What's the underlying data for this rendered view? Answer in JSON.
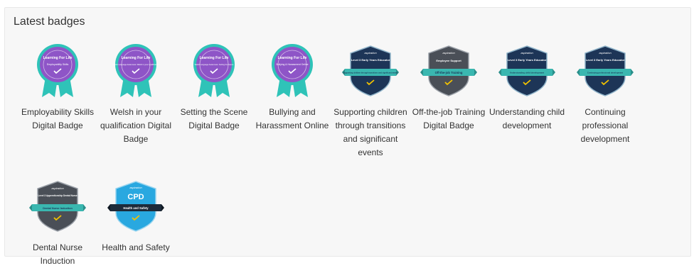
{
  "panel": {
    "title": "Latest badges"
  },
  "badges": [
    {
      "label": "Employability Skills Digital Badge",
      "icon": "rosette-icon",
      "header": "Learning For Life",
      "subtitle": "Employability Skills"
    },
    {
      "label": "Welsh in your qualification Digital Badge",
      "icon": "rosette-icon",
      "header": "Learning For Life",
      "subtitle": "Welsh Language Awareness: Welsh in your Qualification"
    },
    {
      "label": "Setting the Scene Digital Badge",
      "icon": "rosette-icon",
      "header": "Learning For Life",
      "subtitle": "Welsh Language Awareness: Setting the Scene"
    },
    {
      "label": "Bullying and Harassment Online",
      "icon": "rosette-icon",
      "header": "Learning For Life",
      "subtitle": "Bullying & Harassment Online"
    },
    {
      "label": "Supporting children through transitions and significant events",
      "icon": "shield-icon",
      "brand": "aspiration",
      "header": "Level 3 Early Years Educator",
      "ribbon": "Supporting children through transitions and significant events"
    },
    {
      "label": "Off-the-job Training Digital Badge",
      "icon": "shield-icon",
      "brand": "aspiration",
      "header": "Employee Support",
      "ribbon": "Off-the-job Training"
    },
    {
      "label": "Understanding child development",
      "icon": "shield-icon",
      "brand": "aspiration",
      "header": "Level 3 Early Years Educator",
      "ribbon": "Understanding child development"
    },
    {
      "label": "Continuing professional development",
      "icon": "shield-icon",
      "brand": "aspiration",
      "header": "Level 3 Early Years Educator",
      "ribbon": "Continuing professional development"
    },
    {
      "label": "Dental Nurse Induction",
      "icon": "shield-icon",
      "brand": "aspiration",
      "header": "Level 3 Apprenticeship Dental Nurse",
      "ribbon": "Dental Nurse Induction"
    },
    {
      "label": "Health and Safety",
      "icon": "shield-icon",
      "brand": "aspiration",
      "header": "CPD",
      "ribbon": "Health and Safety"
    }
  ],
  "colors": {
    "rosette_purple": "#8e55c7",
    "rosette_teal": "#2fc3b8",
    "shield_navy": "#1d3557",
    "shield_gray": "#4a4f57",
    "shield_blue": "#29a8e0",
    "ribbon_teal": "#3ab7b0",
    "check_yellow": "#f2c200"
  }
}
